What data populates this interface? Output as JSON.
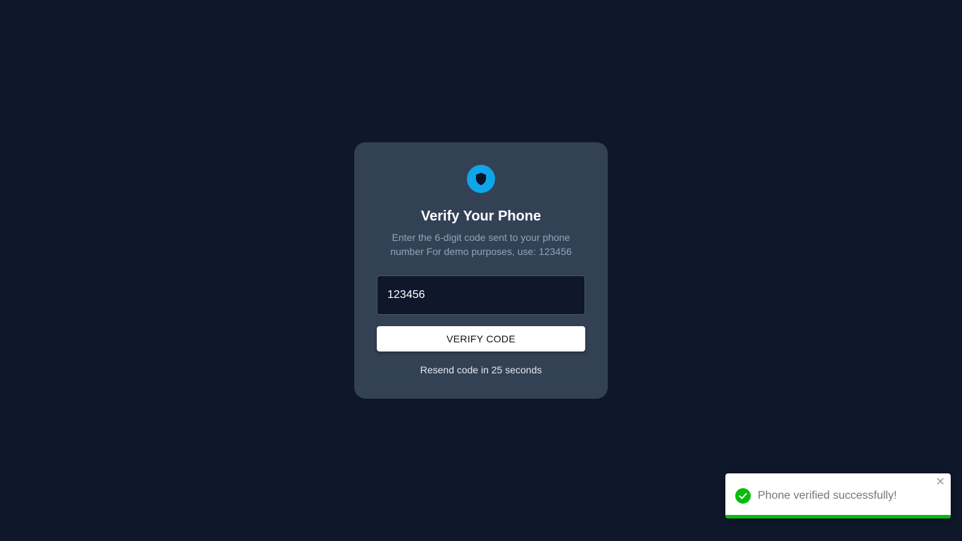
{
  "card": {
    "title": "Verify Your Phone",
    "subtitle": "Enter the 6-digit code sent to your phone number For demo purposes, use: 123456",
    "icon": "shield-icon",
    "code_input": {
      "value": "123456",
      "placeholder": ""
    },
    "verify_label": "VERIFY CODE",
    "resend_text": "Resend code in 25 seconds"
  },
  "toast": {
    "message": "Phone verified successfully!",
    "icon": "check-circle-icon",
    "close_glyph": "✕",
    "progress": 1.0,
    "status_color": "#07bc0c"
  },
  "colors": {
    "background": "#0f172a",
    "card": "#334155",
    "accent": "#0ea5e9"
  }
}
